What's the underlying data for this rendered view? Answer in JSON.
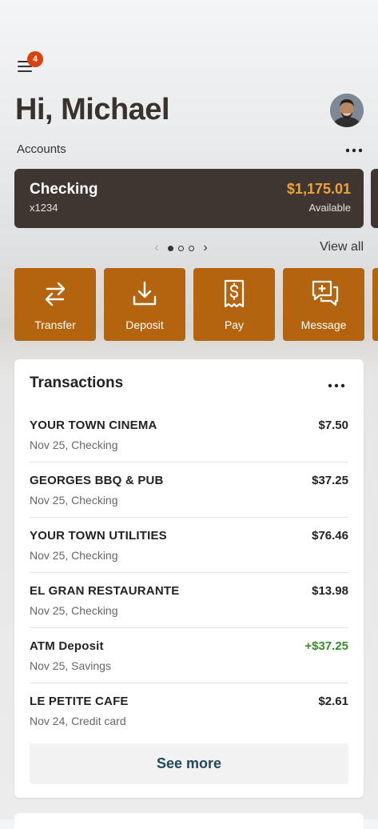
{
  "header": {
    "menu_icon": "hamburger-menu-icon",
    "notification_count": "4",
    "greeting": "Hi, Michael",
    "avatar_icon": "user-avatar"
  },
  "accounts": {
    "label": "Accounts",
    "more_icon": "ellipsis-icon",
    "card": {
      "name": "Checking",
      "number": "x1234",
      "balance": "$1,175.01",
      "balance_label": "Available"
    },
    "pager": {
      "prev": "‹",
      "next": "›",
      "current_page": 1,
      "total_pages": 3
    },
    "view_all": "View all"
  },
  "quick_actions": [
    {
      "label": "Transfer",
      "icon": "transfer-icon"
    },
    {
      "label": "Deposit",
      "icon": "deposit-icon"
    },
    {
      "label": "Pay",
      "icon": "bill-pay-icon"
    },
    {
      "label": "Message",
      "icon": "message-icon"
    }
  ],
  "transactions": {
    "title": "Transactions",
    "more_icon": "ellipsis-icon",
    "items": [
      {
        "merchant": "YOUR TOWN CINEMA",
        "meta": "Nov 25, Checking",
        "amount": "$7.50",
        "credit": false
      },
      {
        "merchant": "GEORGES BBQ & PUB",
        "meta": "Nov 25, Checking",
        "amount": "$37.25",
        "credit": false
      },
      {
        "merchant": "YOUR TOWN UTILITIES",
        "meta": "Nov 25, Checking",
        "amount": "$76.46",
        "credit": false
      },
      {
        "merchant": "EL GRAN RESTAURANTE",
        "meta": "Nov 25, Checking",
        "amount": "$13.98",
        "credit": false
      },
      {
        "merchant": "ATM Deposit",
        "meta": "Nov 25, Savings",
        "amount": "+$37.25",
        "credit": true
      },
      {
        "merchant": "LE PETITE CAFE",
        "meta": "Nov 24, Credit card",
        "amount": "$2.61",
        "credit": false
      }
    ],
    "see_more": "See more"
  },
  "colors": {
    "accent_orange": "#b4640f",
    "card_dark": "#3f3631",
    "balance_gold": "#f0a233",
    "badge_red": "#d8430e",
    "credit_green": "#3b8a2a"
  }
}
